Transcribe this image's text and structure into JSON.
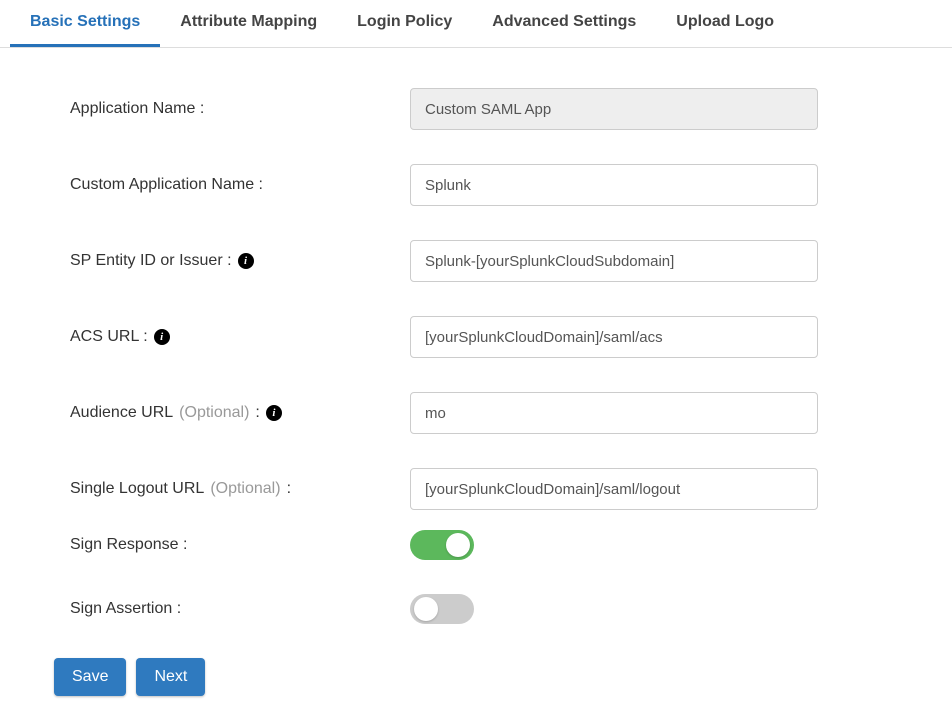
{
  "tabs": {
    "basic": "Basic Settings",
    "attribute": "Attribute Mapping",
    "login": "Login Policy",
    "advanced": "Advanced Settings",
    "upload": "Upload Logo"
  },
  "labels": {
    "app_name": "Application Name :",
    "custom_app_name": "Custom Application Name :",
    "sp_entity": "SP Entity ID or Issuer :",
    "acs_url": "ACS URL :",
    "audience_url_pre": "Audience URL ",
    "audience_url_opt": "(Optional)",
    "audience_url_post": " :",
    "slo_pre": "Single Logout URL ",
    "slo_opt": "(Optional)",
    "slo_post": " :",
    "sign_response": "Sign Response :",
    "sign_assertion": "Sign Assertion :"
  },
  "values": {
    "app_name": "Custom SAML App",
    "custom_app_name": "Splunk",
    "sp_entity": "Splunk-[yourSplunkCloudSubdomain]",
    "acs_url": "[yourSplunkCloudDomain]/saml/acs",
    "audience_url": "mo",
    "slo": "[yourSplunkCloudDomain]/saml/logout"
  },
  "buttons": {
    "save": "Save",
    "next": "Next"
  }
}
